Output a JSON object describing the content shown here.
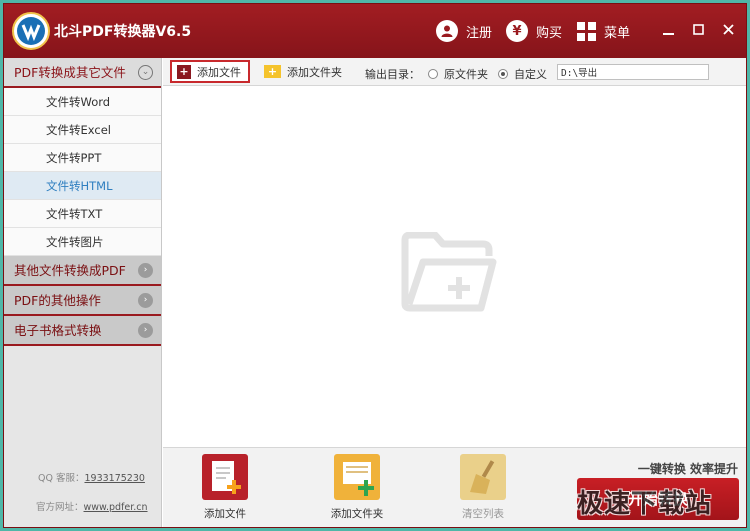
{
  "app": {
    "title": "北斗PDF转换器V6.5"
  },
  "titlebar": {
    "register_label": "注册",
    "buy_label": "购买",
    "menu_label": "菜单",
    "buy_icon_glyph": "¥"
  },
  "sidebar": {
    "sections": [
      {
        "label": "PDF转换成其它文件",
        "expanded": true
      },
      {
        "label": "其他文件转换成PDF",
        "expanded": false
      },
      {
        "label": "PDF的其他操作",
        "expanded": false
      },
      {
        "label": "电子书格式转换",
        "expanded": false
      }
    ],
    "items": [
      {
        "label": "文件转Word",
        "active": false
      },
      {
        "label": "文件转Excel",
        "active": false
      },
      {
        "label": "文件转PPT",
        "active": false
      },
      {
        "label": "文件转HTML",
        "active": true
      },
      {
        "label": "文件转TXT",
        "active": false
      },
      {
        "label": "文件转图片",
        "active": false
      }
    ],
    "footer": {
      "qq_label": "QQ 客服：",
      "qq_number": "1933175230",
      "website_label": "官方网址：",
      "website": "www.pdfer.cn"
    }
  },
  "toolbar": {
    "add_file_label": "添加文件",
    "add_folder_label": "添加文件夹",
    "output_dir_label": "输出目录：",
    "option_original_label": "原文件夹",
    "option_custom_label": "自定义",
    "selected_option": "custom",
    "output_path": "D:\\导出"
  },
  "bottom": {
    "add_file_label": "添加文件",
    "add_folder_label": "添加文件夹",
    "clear_list_label": "清空列表",
    "slogan": "一键转换  效率提升",
    "start_label": "开始转换"
  },
  "watermark": "极速下载站",
  "colors": {
    "brand_red": "#9a1a1f",
    "accent_blue": "#2f7fc0",
    "folder_yellow": "#f5c32c"
  }
}
